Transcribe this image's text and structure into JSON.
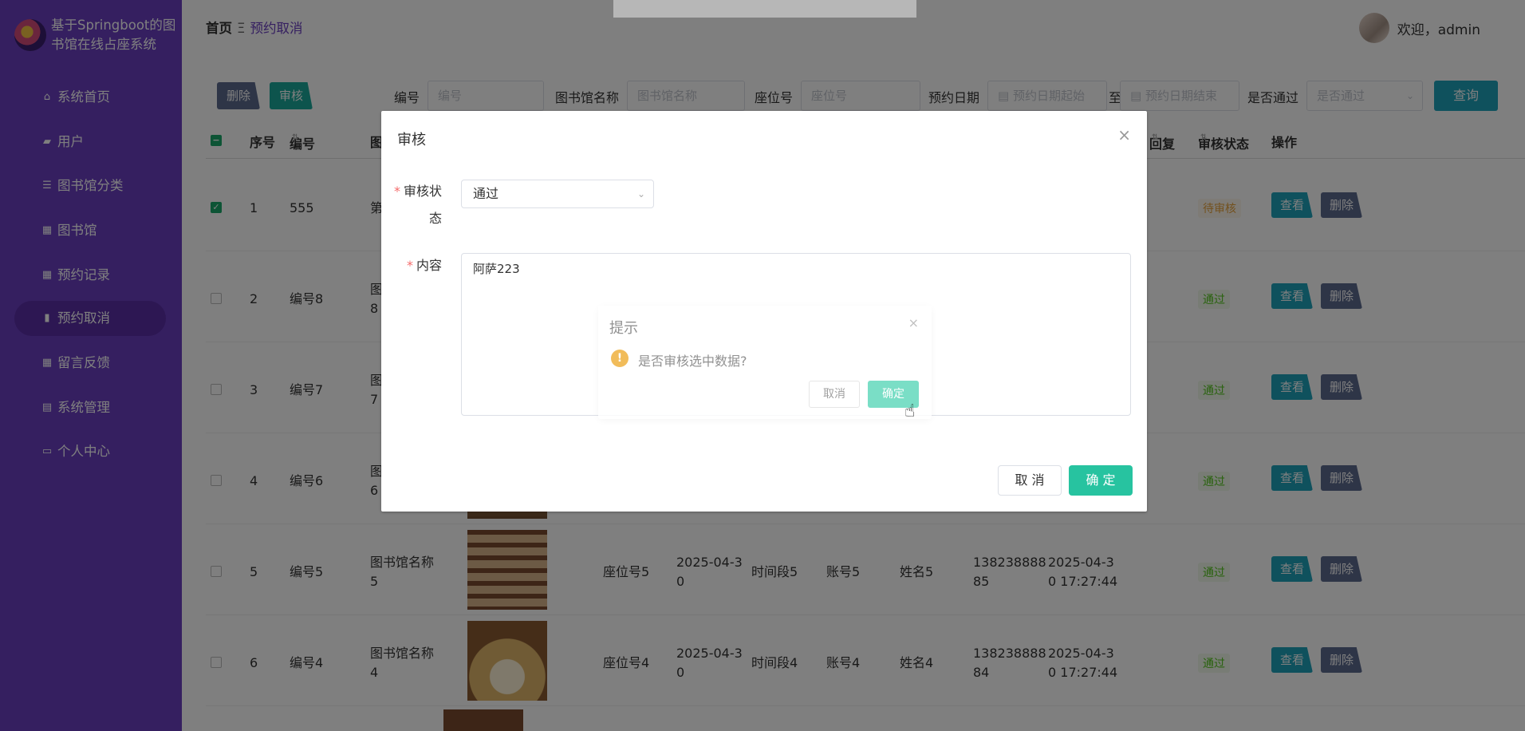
{
  "sidebar": {
    "brand": "基于Springboot的图书馆在线占座系统",
    "items": [
      {
        "label": "系统首页",
        "icon": "home-icon"
      },
      {
        "label": "用户",
        "icon": "user-icon"
      },
      {
        "label": "图书馆分类",
        "icon": "sliders-icon"
      },
      {
        "label": "图书馆",
        "icon": "grid-icon"
      },
      {
        "label": "预约记录",
        "icon": "grid-icon"
      },
      {
        "label": "预约取消",
        "icon": "book-icon",
        "active": true
      },
      {
        "label": "留言反馈",
        "icon": "grid-icon"
      },
      {
        "label": "系统管理",
        "icon": "clipboard-icon"
      },
      {
        "label": "个人中心",
        "icon": "id-card-icon"
      }
    ]
  },
  "header": {
    "breadcrumb_home": "首页",
    "breadcrumb_sep": "Ξ",
    "breadcrumb_current": "预约取消",
    "welcome": "欢迎，admin"
  },
  "toolbar": {
    "delete": "删除",
    "audit": "审核",
    "filters": [
      {
        "label": "编号",
        "placeholder": "编号"
      },
      {
        "label": "图书馆名称",
        "placeholder": "图书馆名称"
      },
      {
        "label": "座位号",
        "placeholder": "座位号"
      },
      {
        "label": "预约日期",
        "placeholder": "预约日期起始"
      },
      {
        "label": "至",
        "placeholder": "预约日期结束"
      },
      {
        "label": "是否通过",
        "placeholder": "是否通过"
      }
    ],
    "query": "查询"
  },
  "table": {
    "headers": {
      "index": "序号",
      "code": "编号",
      "lib": "图",
      "reply": "回复",
      "status": "审核状态",
      "ops": "操作"
    },
    "rows": [
      {
        "index": "1",
        "code": "555",
        "lib": "第",
        "status": "待审核",
        "checked": true
      },
      {
        "index": "2",
        "code": "编号8",
        "lib": "图\n8",
        "status": "通过"
      },
      {
        "index": "3",
        "code": "编号7",
        "lib": "图\n7",
        "status": "通过"
      },
      {
        "index": "4",
        "code": "编号6",
        "lib": "图\n6",
        "status": "通过"
      },
      {
        "index": "5",
        "code": "编号5",
        "lib": "图书馆名称\n5",
        "seat": "座位号5",
        "date": "2025-04-3\n0",
        "slot": "时间段5",
        "account": "账号5",
        "name": "姓名5",
        "phone": "138238888\n85",
        "time": "2025-04-3\n0 17:27:44",
        "status": "通过"
      },
      {
        "index": "6",
        "code": "编号4",
        "lib": "图书馆名称\n4",
        "seat": "座位号4",
        "date": "2025-04-3\n0",
        "slot": "时间段4",
        "account": "账号4",
        "name": "姓名4",
        "phone": "138238888\n84",
        "time": "2025-04-3\n0 17:27:44",
        "status": "通过"
      }
    ],
    "view": "查看",
    "delete": "删除"
  },
  "dialog": {
    "title": "审核",
    "status_label": "审核状\n态",
    "status_value": "通过",
    "content_label": "内容",
    "content_value": "阿萨223",
    "cancel": "取 消",
    "ok": "确 定"
  },
  "confirm": {
    "title": "提示",
    "message": "是否审核选中数据?",
    "cancel": "取消",
    "ok": "确定"
  }
}
